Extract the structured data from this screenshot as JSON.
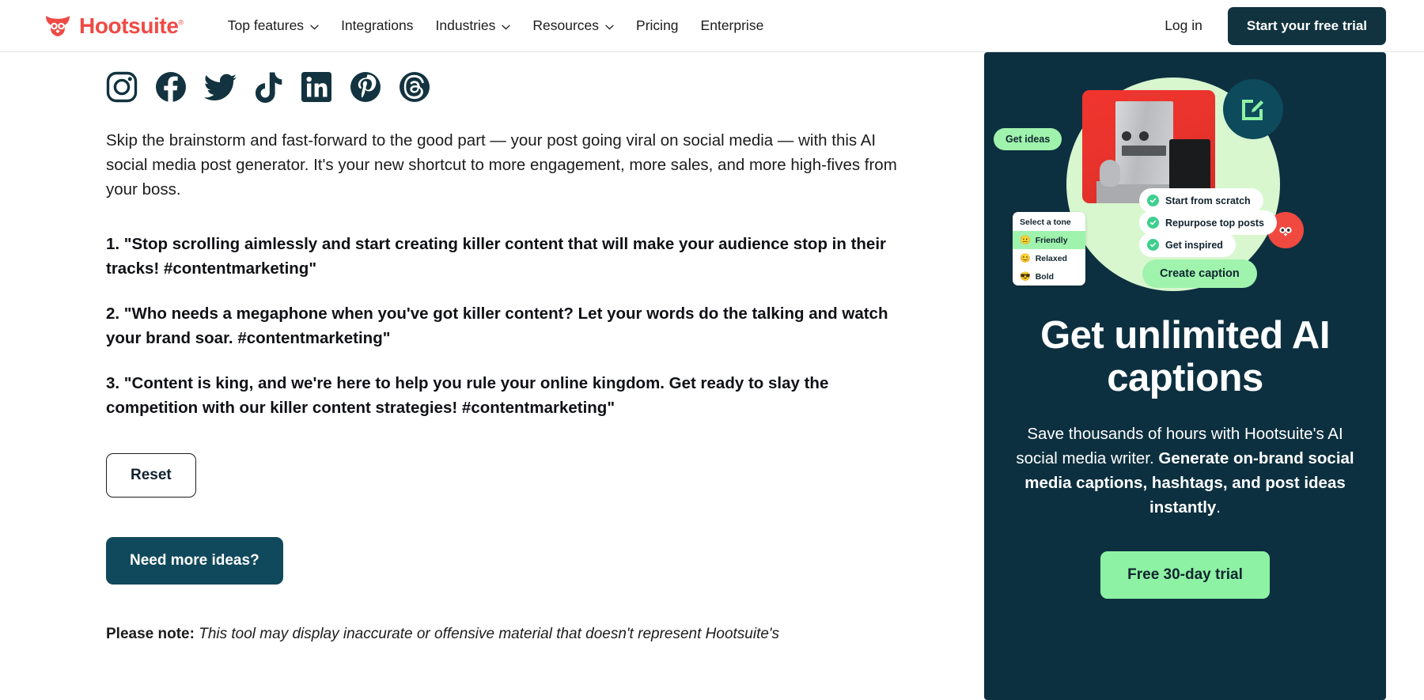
{
  "header": {
    "logo_text": "Hootsuite",
    "logo_tm": "®",
    "logo_icon": "hootsuite-owl-logo",
    "nav": [
      {
        "label": "Top features",
        "has_caret": true
      },
      {
        "label": "Integrations",
        "has_caret": false
      },
      {
        "label": "Industries",
        "has_caret": true
      },
      {
        "label": "Resources",
        "has_caret": true
      },
      {
        "label": "Pricing",
        "has_caret": false
      },
      {
        "label": "Enterprise",
        "has_caret": false
      }
    ],
    "login_label": "Log in",
    "trial_label": "Start your free trial"
  },
  "social_icons": [
    "instagram-icon",
    "facebook-icon",
    "twitter-icon",
    "tiktok-icon",
    "linkedin-icon",
    "pinterest-icon",
    "threads-icon"
  ],
  "main": {
    "intro": "Skip the brainstorm and fast-forward to the good part — your post going viral on social media — with this AI social media post generator. It's your new shortcut to more engagement, more sales, and more high-fives from your boss.",
    "results": [
      "1. \"Stop scrolling aimlessly and start creating killer content that will make your audience stop in their tracks! #contentmarketing\"",
      "2. \"Who needs a megaphone when you've got killer content? Let your words do the talking and watch your brand soar. #contentmarketing\"",
      "3. \"Content is king, and we're here to help you rule your online kingdom. Get ready to slay the competition with our killer content strategies! #contentmarketing\""
    ],
    "reset_label": "Reset",
    "more_ideas_label": "Need more ideas?",
    "disclaimer_label": "Please note:",
    "disclaimer_text": " This tool may display inaccurate or offensive material that doesn't represent Hootsuite's"
  },
  "promo": {
    "title": "Get unlimited AI captions",
    "body_lead": "Save thousands of hours with Hootsuite's AI social media writer. ",
    "body_bold": "Generate on-brand social media captions, hashtags, and post ideas instantly",
    "body_tail": ".",
    "cta_label": "Free 30-day trial",
    "illustration": {
      "get_ideas_pill": "Get ideas",
      "edit_badge_icon": "compose-edit-icon",
      "owl_badge_icon": "hootsuite-owl-icon",
      "checks": [
        "Start from scratch",
        "Repurpose top posts",
        "Get inspired"
      ],
      "tone_title": "Select a tone",
      "tones": [
        {
          "label": "Friendly",
          "emoji": "😐",
          "selected": true
        },
        {
          "label": "Relaxed",
          "emoji": "😊",
          "selected": false
        },
        {
          "label": "Bold",
          "emoji": "😎",
          "selected": false
        }
      ],
      "create_label": "Create caption"
    }
  },
  "colors": {
    "brand_red": "#ef4a45",
    "dark_navy": "#0d3040",
    "button_navy": "#11495c",
    "mint_green": "#8ef2a4",
    "pale_green": "#d8f7cf",
    "header_navy": "#11333f"
  }
}
